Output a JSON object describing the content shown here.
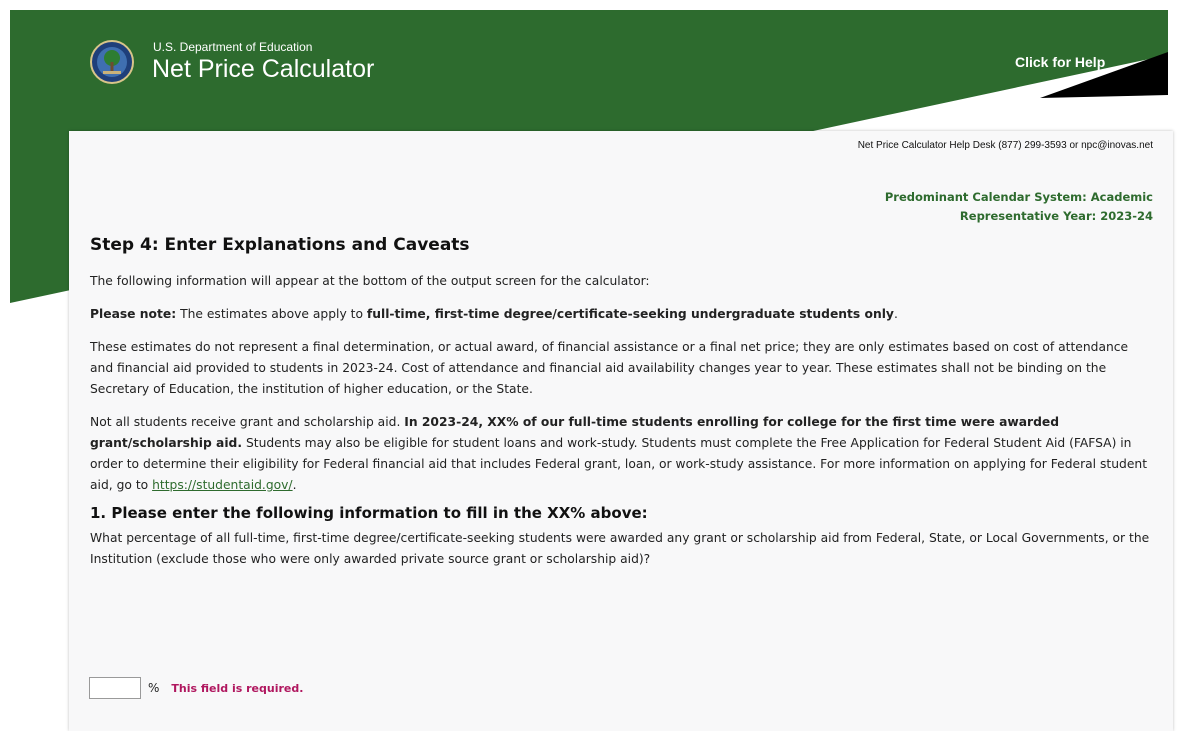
{
  "header": {
    "agency": "U.S. Department of Education",
    "title": "Net Price Calculator",
    "help_label": "Click for Help",
    "seal_icon": "doe-seal-icon"
  },
  "colors": {
    "header_green": "#2d6b2e",
    "header_black": "#000000",
    "accent_green": "#2e6b2e",
    "error_magenta": "#b0175f"
  },
  "helpdesk": "Net Price Calculator Help Desk (877) 299-3593 or npc@inovas.net",
  "calendar": {
    "system": "Predominant Calendar System: Academic",
    "year": "Representative Year: 2023-24"
  },
  "step": {
    "title": "Step 4: Enter Explanations and Caveats",
    "intro": "The following information will appear at the bottom of the output screen for the calculator:",
    "note_label": "Please note:",
    "note_text": " The estimates above apply to ",
    "note_bold": "full-time, first-time degree/certificate-seeking undergraduate students only",
    "note_end": ".",
    "estimates_text": "These estimates do not represent a final determination, or actual award, of financial assistance or a final net price; they are only estimates based on cost of attendance and financial aid provided to students in 2023-24. Cost of attendance and financial aid availability changes year to year. These estimates shall not be binding on the Secretary of Education, the institution of higher education, or the State.",
    "aid_text_1": "Not all students receive grant and scholarship aid. ",
    "aid_bold": "In 2023-24, XX% of our full-time students enrolling for college for the first time were awarded grant/scholarship aid.",
    "aid_text_2": " Students may also be eligible for student loans and work-study. Students must complete the Free Application for Federal Student Aid (FAFSA) in order to determine their eligibility for Federal financial aid that includes Federal grant, loan, or work-study assistance. For more information on applying for Federal student aid, go to ",
    "aid_link": "https://studentaid.gov/",
    "aid_end": "."
  },
  "question": {
    "title": "1. Please enter the following information to fill in the XX% above:",
    "text": "What percentage of all full-time, first-time degree/certificate-seeking students were awarded any grant or scholarship aid from Federal, State, or Local Governments, or the Institution (exclude those who were only awarded private source grant or scholarship aid)?",
    "input_value": "",
    "unit": "%",
    "error": "This field is required."
  }
}
